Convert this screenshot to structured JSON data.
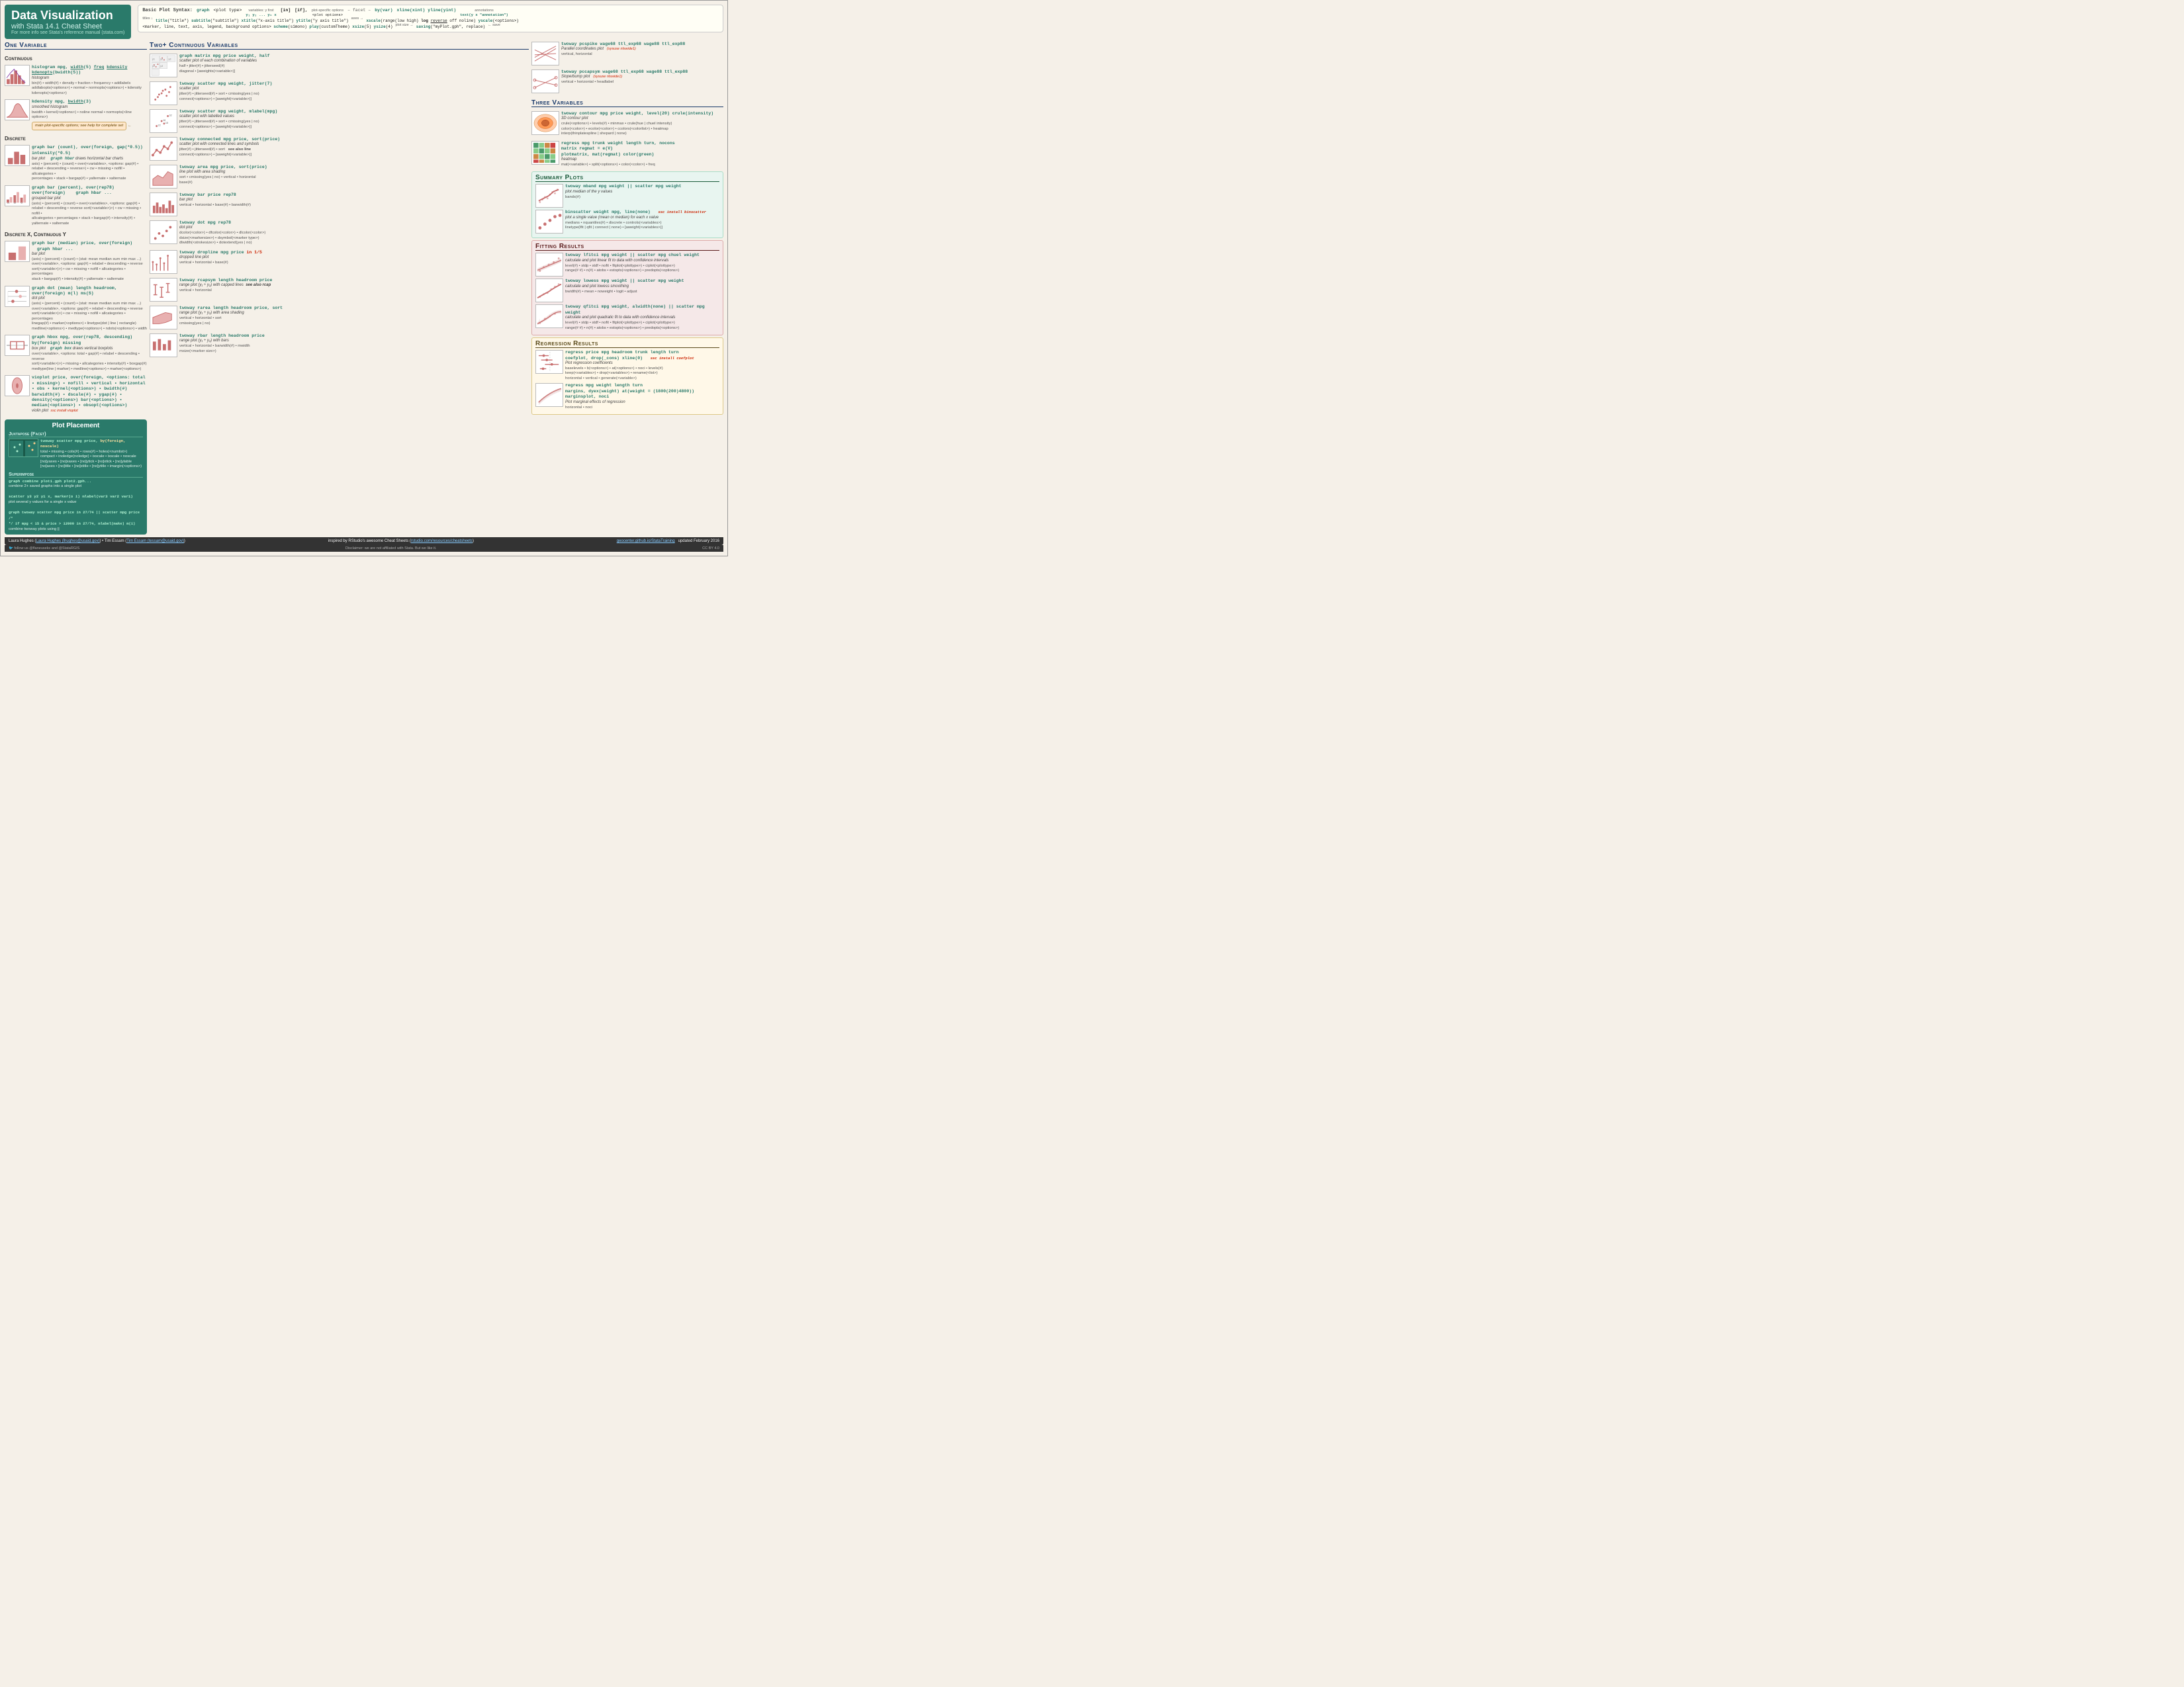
{
  "header": {
    "title": "Data Visualization",
    "subtitle": "with Stata 14.1   Cheat Sheet",
    "moreinfo": "For more info see Stata's reference manual (stata.com)",
    "syntax_title": "Basic Plot Syntax:",
    "syntax_line1_parts": [
      "graph",
      "<plot type>",
      "variables: y first",
      "y₁ y₂ ... yₙ x",
      "[in]",
      "[if],",
      "<plot options>",
      "– facet –",
      "by(var)",
      "xline(xint) yline(yint)",
      "annotations",
      "text(y x \"annotation\")"
    ],
    "syntax_line2": "title(\"title\") subtitle(\"subtitle\") xtitle(\"x-axis title\") ytitle(\"y axis title\")   xscale(range(low high) log reverse off noline) yscale(<options>)",
    "syntax_line3": "<marker, line, text, axis, legend, background options> scheme(s1mono) play(customTheme) xsize(5) ysize(4)  saving(\"myPlot.gph\", replace)"
  },
  "one_variable": {
    "header": "One Variable",
    "continuous_header": "Continuous",
    "histogram_code": "histogram mpg, width(5) freq kdensity kdenopts(bwidth(5))",
    "histogram_name": "histogram",
    "histogram_options": "bin(#) • width(#) • density • fraction • frequency • addlabels addlabopts(<options>) • normal • normopts(<options>) • kdensity kdenopts(<options>)",
    "kdensity_code": "kdensity mpg, bwidth(3)",
    "kdensity_name": "smoothed histogram",
    "kdensity_options": "bwidth • kernel(<options>) • noline normal • normopts(<line options>)",
    "discrete_header": "Discrete",
    "graphbar_code": "graph bar (count), over(foreign, gap(*0.5)) intensity(*0.5)",
    "graphbar_name": "bar plot",
    "graphbar_hbar": "graph hbar draws horizontal bar charts",
    "graphbar_options": "axis) • (percent) • (count) • over(<variables>, <options: gap(#) • relabel • descending • reverse>) • cw • missing • nofill • allcategories • percentages • stack • bargap(#) • yalternate • xalternate",
    "graphbar2_code": "graph bar (percent), over(rep78) over(foreign)",
    "graphbar2_name": "grouped bar plot",
    "graphbar2_hbar": "graph hbar ...",
    "graphbar2_options": "(axis) • (percent) • (count) • over(<variables>, <options: gap(#) • relabel • descending • reverse sort(<variable>)>) • cw • missing • nofill • allcategories • percentages • stack • bargap(#) • intensity(#) • yalternate • xalternate",
    "discrete_x_cont_y": "Discrete X, Continuous Y",
    "graphbar_median": "graph bar (median) price, over(foreign)",
    "graphbar_median_hbar": "graph hbar ...",
    "graphbar_median_options": "bar plot (axis) • (percent) • (count) • (stat: mean median sum min max ...) over(<variable>, <options: gap(#) • relabel • descending • reverse sort(<variable>)>) • cw • missing • nofill • allcategories • percentages stack • bargap(#) • intensity(#) • yalternate • xalternate",
    "graphdot_code": "graph dot (mean) length headroom, over(foreign) m(l) ms(S)",
    "graphdot_name": "dot plot (axis) • (percent) • (count) • (stat: mean median sum min max ...) over(<variable>, <options: gap(#) • relabel • descending • reverse sort(<variable>)>) • cw • missing • nofill • allcategories • percentages linegap(#) • marker(<options>) • linetype(dot | line | rectangle) medline(<options>) • medtype(<options>) • ndots(<options>) • width",
    "graphhbox_code": "graph hbox mpg, over(rep78, descending) by(foreign) missing",
    "graphhbox_name": "box plot",
    "graphhbox_graphbox": "graph box draws vertical boxplots",
    "graphhbox_options": "over(<variable>, <options: total • gap(#) • relabel • descending • reverse sort(<variable>)>) • missing • allcategories • intensity(#) • boxgap(#) medtype(line | marker) • medline(<options>) • marker(<options>)",
    "vioplot_code": "vioplot price, over(foreign, <options: total • missing>) • nofill • vertical • horizontal • obs • kernel(<options>) • bwidth(#) barwidth(#) • dscale(#) • ygap(#) • density(<options>) bar(<options>) • median(<options>) • obsopt(<options>)",
    "vioplot_name": "violin plot",
    "vioplot_ssc": "ssc install vioplot"
  },
  "two_continuous": {
    "header": "Two+ Continuous Variables",
    "graphmatrix_code": "graph matrix mpg price weight, half",
    "graphmatrix_desc": "scatter plot of each combination of variables",
    "graphmatrix_options": "half • jitter(#) • jitterseed(#) diagonal • [aweights(<variable>)]",
    "twoway_scatter_code": "twoway scatter mpg weight, jitter(7)",
    "twoway_scatter_desc": "scatter plot",
    "twoway_scatter_options": "jitter(#) • jitterseed(#) • sort • cmissing(yes | no) connect(<options>) • [aweight(<variable>)]",
    "twoway_scatter_mlabel_code": "twoway scatter mpg weight, mlabel(mpg)",
    "twoway_scatter_mlabel_desc": "scatter plot with labelled values",
    "twoway_scatter_mlabel_options": "jitter(#) • jitterseed(#) • sort • cmissing(yes | no) connect(<options>) • [aweight(<variable>)]",
    "twoway_connected_code": "twoway connected mpg price, sort(price)",
    "twoway_connected_desc": "scatter plot with connected lines and symbols",
    "twoway_connected_options": "jitter(#) • jitterseed(#) • sort   see also line connect(<options>) • [aweight(<variable>)]",
    "twoway_area_code": "twoway area mpg price, sort(price)",
    "twoway_area_desc": "line plot with area shading",
    "twoway_area_options": "sort • cmissing(yes | no) • vertical • horizontal base(#)",
    "twoway_bar_code": "twoway bar price rep78",
    "twoway_bar_desc": "bar plot",
    "twoway_bar_options": "vertical • horizontal • base(#) • barwidth(#)",
    "twoway_dot_code": "twoway dot mpg rep78",
    "twoway_dot_desc": "dot plot",
    "twoway_dot_options": "dcolor(<color>) • dfcolor(<color>) • dlcolor(<color>) dsize(<markersize>) • dsymbol(<marker type>) dlwidth(<strokesize>) • dotextendyes | no",
    "twoway_dropline_code": "twoway dropline mpg price in 1/5",
    "twoway_dropline_desc": "dropped line plot",
    "twoway_dropline_options": "vertical • horizontal • base(#)",
    "twoway_rcapsym_code": "twoway rcapsym length headroom price",
    "twoway_rcapsym_desc": "range plot (y₁ ÷ y₂) with capped lines",
    "twoway_rcapsym_see": "see also rcap",
    "twoway_rcapsym_options": "vertical • horizontal",
    "twoway_rarea_code": "twoway rarea length headroom price, sort",
    "twoway_rarea_desc": "range plot (y₁ ÷ y₂) with area shading",
    "twoway_rarea_options": "vertical • horizontal • sort cmissing(yes | no)",
    "twoway_rbar_code": "twoway rbar length headroom price",
    "twoway_rbar_desc": "range plot (y₁ ÷ y₂) with bars",
    "twoway_rbar_options": "vertical • horizontal • barwidth(#) • mwidth msize(<marker size>)"
  },
  "right_panel": {
    "twoway_pcspike_code": "twoway pcspike wage68 ttl_exp68 wage88 ttl_exp88",
    "twoway_pcspike_desc": "Parallel coordinates plot",
    "twoway_pcspike_options": "vertical, horizontal",
    "twoway_pcspike_sysuse": "(sysuse nlswide1)",
    "twoway_pccapsym_code": "twoway pccapsym wage68 ttl_exp68 wage88 ttl_exp88",
    "twoway_pccapsym_desc": "Slope/bump plot",
    "twoway_pccapsym_options": "vertical • horizontal • headlabel",
    "twoway_pccapsym_sysuse": "(sysuse nlswide1)",
    "three_variables": "Three Variables",
    "twoway_contour_code": "twoway contour mpg price weight, level(20) crule(intensity)",
    "twoway_contour_desc": "3D contour plot",
    "twoway_contour_options": "crule(<options>) • levels(#) • minmax • crule(hue | chuel intensity) color(<color>) • ecolor(<color>) • ccolors(<colorlist>) • heatmap interp(thinplatespline | shepard | none)",
    "regress_code": "regress mpg trunk weight length turn, nocons",
    "matrix_code": "matrix regmat = e(V)",
    "plotmatrix_code": "plotmatrix, mat(regmat) color(green)",
    "plotmatrix_desc": "heatmap",
    "plotmatrix_options": "mat(<variable>) • split(<options>) • color(<color>) • freq",
    "summary_header": "Summary Plots",
    "twoway_mband_code": "twoway mband mpg weight || scatter mpg weight",
    "twoway_mband_desc": "plot median of the y values",
    "twoway_mband_options": "bands(#)",
    "binscatter_code": "binscatter weight mpg, line(none)",
    "binscatter_desc": "plot a single value (mean or median) for each x value",
    "binscatter_ssc": "ssc install binscatter",
    "binscatter_options": "medians • nquantiles(#) • discrete • controls(<variables>) linetype(lfit | qfit | connect | none) • [aweight(<variables>)]",
    "fitting_header": "Fitting Results",
    "twoway_lfitci_code": "twoway lfitci mpg weight || scatter mpg chuel weight",
    "twoway_lfitci_desc": "calculate and plot linear fit to data with confidence intervals",
    "twoway_lfitci_options": "level(#) • stdp • stdf • nofit • fitplot(<plottype>) • ciplot(<plottype>) range(# #) • n(#) • atobs • estopts(<options>) • predopts(<options>)",
    "twoway_lowess_code": "twoway lowess mpg weight || scatter mpg weight",
    "twoway_lowess_desc": "calculate and plot lowess smoothing",
    "twoway_lowess_options": "bwidth(#) • mean • noweight • logit • adjust",
    "twoway_qfitci_code": "twoway qfitci mpg weight, alwidth(none) || scatter mpg weight",
    "twoway_qfitci_desc": "calculate and plot quadratic fit to data with confidence intervals",
    "twoway_qfitci_options": "level(#) • stdp • stdf • nofit • fitplot(<plottype>) • ciplot(<plottype>) range(# #) • n(#) • atobs • estopts(<options>) • predopts(<options>)",
    "regression_header": "Regression Results",
    "regress2_code": "regress price mpg headroom trunk length turn",
    "coefplot_code": "coefplot, drop(_cons) xline(0)",
    "coefplot_desc": "Plot regression coefficients",
    "coefplot_ssc": "ssc install coefplot",
    "coefplot_options": "baselevels • b(<options>) • at(<options>) • noci • levels(#) keep(<variables>) • drop(<variables>) • rename(<list>) horizontal • vertical • generate(<variable>)",
    "regress3_code": "regress mpg weight length turn",
    "margins_code": "margins, dyex(weight) at(weight = (1800(200)4800))",
    "marginsplot_code": "marginsplot, noci",
    "marginsplot_desc": "Plot marginal effects of regression",
    "marginsplot_options": "horizontal • noci"
  },
  "plot_placement": {
    "header": "Plot Placement",
    "juxtapose_header": "Juxtapose (Facet)",
    "juxtapose_code": "twoway scatter mpg price, by(foreign, noscale)",
    "juxtapose_options": "total • missing • cols(#) • rows(#) • holes(<numlist>) compact • inoledge(noledge) • ixscale • ixscale • noscale [no]yaxes • [no]xaxes • [no]ytick • [no]xtick • [no]ylable [no]axes • [no]title • [no]xtitle • [no]ytitle • imargin(<options>)",
    "note_bubble": "main plot-specific options; see help for complete set",
    "superimpose_header": "Superimpose",
    "superimpose_combine": "graph combine plot1.gph plot2.gph...",
    "superimpose_combine_desc": "combine 2+ saved graphs into a single plot",
    "superimpose_scatter": "scatter y3 y2 y1 x, marker(o i) mlabel(var3 var2 var1)",
    "superimpose_scatter_desc": "plot several y values for a single x value",
    "superimpose_twoway": "graph twoway scatter mpg price in 27/74 || scatter mpg price /*",
    "superimpose_twoway2": "*/ if mpg < 15  & price > 12000 in 27/74, mlabel(make) m(i)",
    "superimpose_twoway_desc": "combine twoway plots using ||"
  },
  "footer": {
    "author1": "Laura Hughes (lhughes@usaid.gov)",
    "author2": "Tim Essam (tessam@usaid.gov)",
    "inspired": "inspired by RStudio's awesome Cheat Sheets (rstudio.com/resources/cheatsheets)",
    "geocenter": "geocenter.github.io/StataTraining",
    "updated": "updated February 2016",
    "twitter": "follow us @flaneuseks and @StataRGIS",
    "disclaimer": "Disclaimer: we are not affiliated with Stata. But we like it.",
    "license": "CC BY 4.0"
  }
}
